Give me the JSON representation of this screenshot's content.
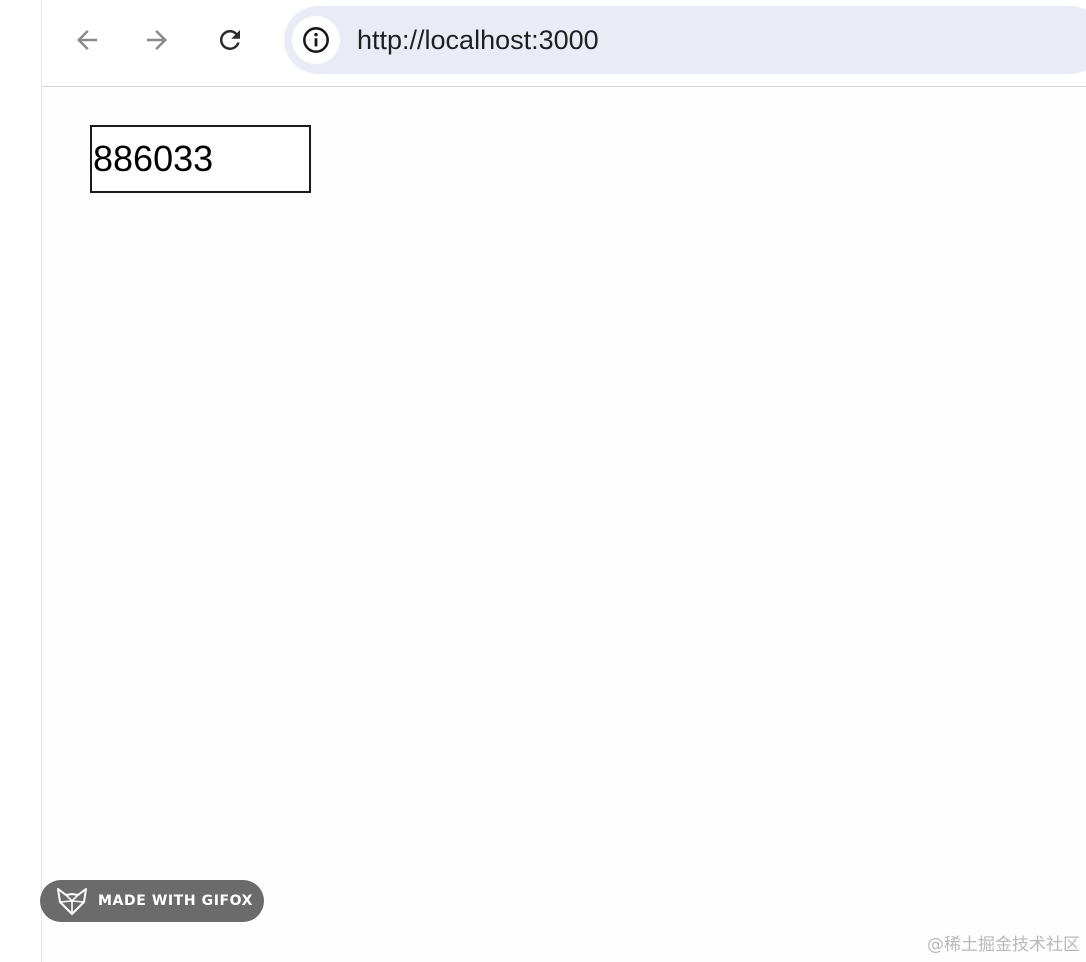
{
  "browser": {
    "url": "http://localhost:3000",
    "icons": {
      "back": "arrow-left-icon",
      "forward": "arrow-right-icon",
      "reload": "reload-icon",
      "site_info": "info-icon"
    }
  },
  "page": {
    "number_input_value": "886033"
  },
  "overlay": {
    "gifox_label": "MADE WITH GIFOX",
    "watermark": "@稀土掘金技术社区"
  },
  "colors": {
    "omnibox_bg": "#e9ecf5",
    "badge_bg": "#6b6b6b",
    "input_border": "#1a1a1a"
  }
}
